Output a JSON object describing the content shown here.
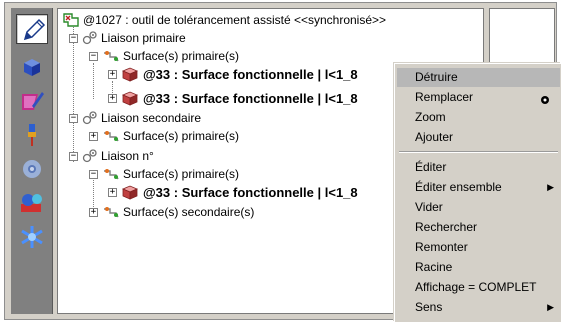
{
  "tree": {
    "root": "@1027 : outil de tolérancement assisté <<synchronisé>>",
    "nodes": [
      {
        "label": "Liaison primaire"
      },
      {
        "label": "Surface(s) primaire(s)"
      },
      {
        "label": "@33 : Surface fonctionnelle | l<1_8"
      },
      {
        "label": "@33 : Surface fonctionnelle | l<1_8"
      },
      {
        "label": "Liaison secondaire"
      },
      {
        "label": "Surface(s) primaire(s)"
      },
      {
        "label": "Liaison n°"
      },
      {
        "label": "Surface(s) primaire(s)"
      },
      {
        "label": "@33 : Surface fonctionnelle | l<1_8"
      },
      {
        "label": "Surface(s) secondaire(s)"
      }
    ]
  },
  "menu": {
    "items": [
      {
        "label": "Détruire"
      },
      {
        "label": "Remplacer"
      },
      {
        "label": "Zoom"
      },
      {
        "label": "Ajouter"
      },
      {
        "label": "Éditer"
      },
      {
        "label": "Éditer ensemble"
      },
      {
        "label": "Vider"
      },
      {
        "label": "Rechercher"
      },
      {
        "label": "Remonter"
      },
      {
        "label": "Racine"
      },
      {
        "label": "Affichage = COMPLET"
      },
      {
        "label": "Sens"
      }
    ]
  },
  "icons": [
    "pencil-icon",
    "cube-icon",
    "edit-shape-icon",
    "pin-icon",
    "gear-icon",
    "tools-icon",
    "snowflake-icon",
    "tree-root-icon",
    "assembly-icon",
    "surface-icon",
    "part-icon"
  ]
}
